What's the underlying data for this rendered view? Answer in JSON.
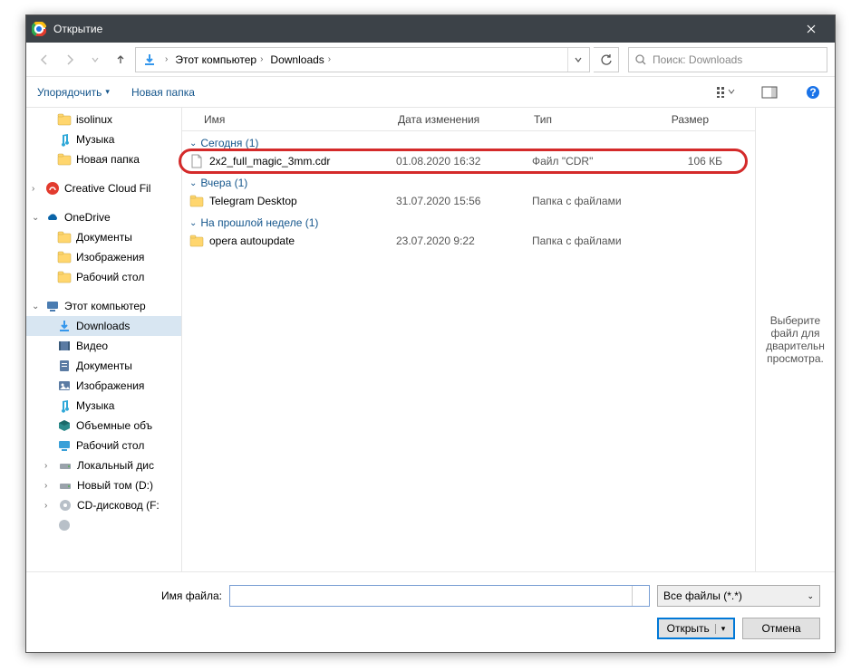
{
  "title": "Открытие",
  "nav": {
    "crumb1": "Этот компьютер",
    "crumb2": "Downloads",
    "search_placeholder": "Поиск: Downloads"
  },
  "toolbar": {
    "organize": "Упорядочить",
    "newfolder": "Новая папка"
  },
  "tree": {
    "isolinux": "isolinux",
    "music1": "Музыка",
    "newfolder": "Новая папка",
    "cc": "Creative Cloud Fil",
    "onedrive": "OneDrive",
    "od_docs": "Документы",
    "od_images": "Изображения",
    "od_desktop": "Рабочий стол",
    "thispc": "Этот компьютер",
    "downloads": "Downloads",
    "video": "Видео",
    "documents": "Документы",
    "images": "Изображения",
    "music2": "Музыка",
    "objects": "Объемные объ",
    "desktop": "Рабочий стол",
    "localdisk": "Локальный дис",
    "newvol": "Новый том (D:)",
    "cdrom": "CD-дисковод (F:"
  },
  "columns": {
    "name": "Имя",
    "date": "Дата изменения",
    "type": "Тип",
    "size": "Размер"
  },
  "groups": {
    "today": "Сегодня (1)",
    "yesterday": "Вчера (1)",
    "lastweek": "На прошлой неделе (1)"
  },
  "files": {
    "f1_name": "2x2_full_magic_3mm.cdr",
    "f1_date": "01.08.2020 16:32",
    "f1_type": "Файл \"CDR\"",
    "f1_size": "106 КБ",
    "f2_name": "Telegram Desktop",
    "f2_date": "31.07.2020 15:56",
    "f2_type": "Папка с файлами",
    "f3_name": "opera autoupdate",
    "f3_date": "23.07.2020 9:22",
    "f3_type": "Папка с файлами"
  },
  "preview": "Выберите файл для дварительн просмотра.",
  "footer": {
    "filename_label": "Имя файла:",
    "filter": "Все файлы (*.*)",
    "open": "Открыть",
    "cancel": "Отмена"
  }
}
